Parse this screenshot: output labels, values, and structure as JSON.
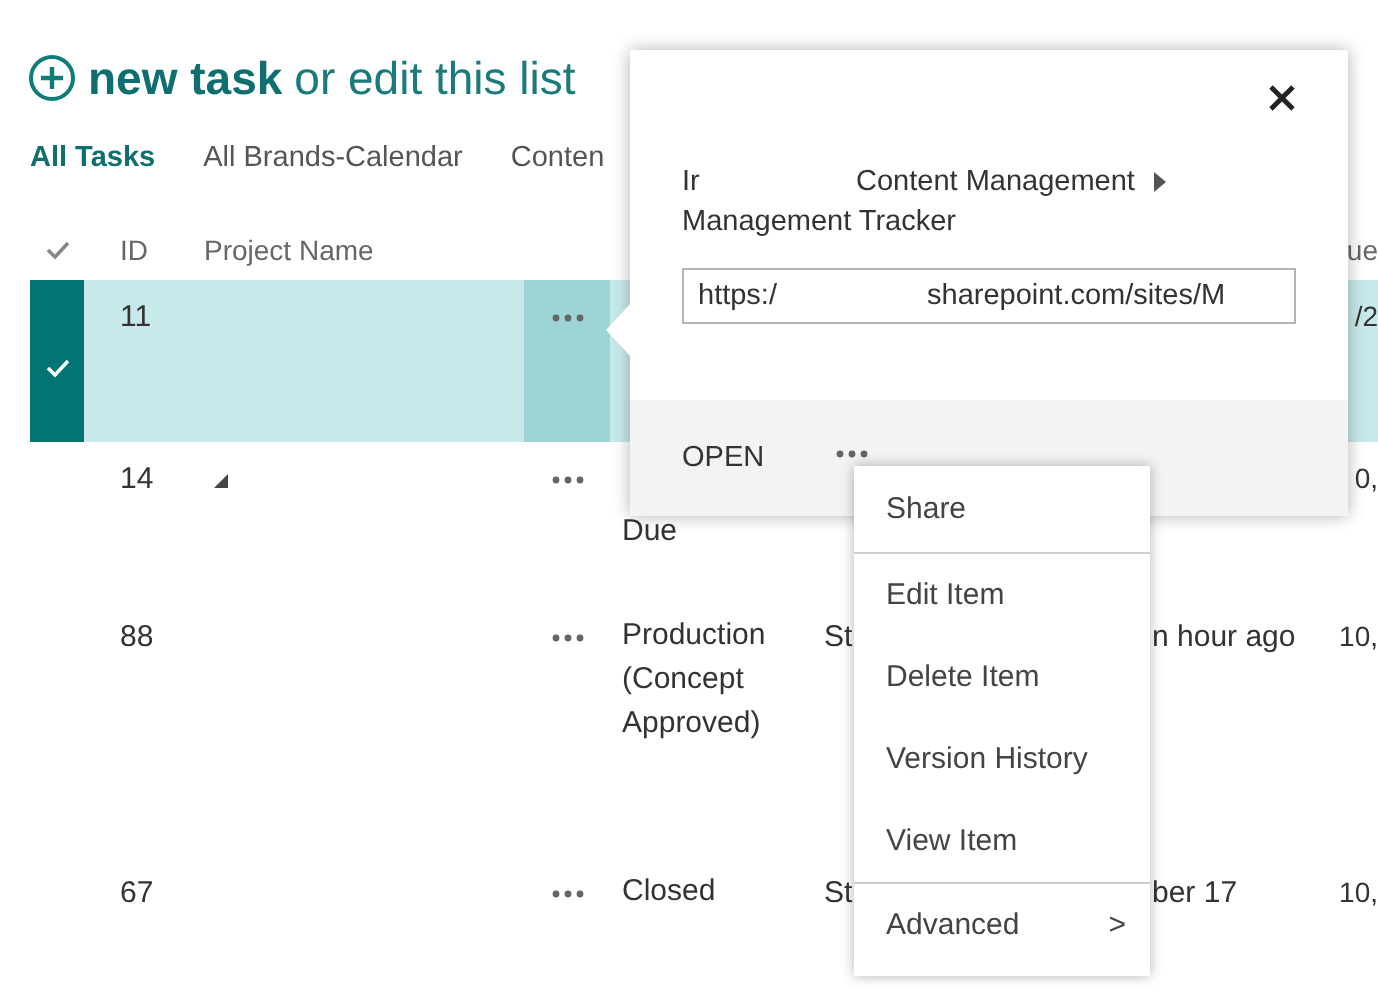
{
  "header": {
    "title_bold": "new task",
    "title_rest": "or edit this list"
  },
  "views": [
    {
      "label": "All Tasks",
      "selected": true
    },
    {
      "label": "All Brands-Calendar",
      "selected": false
    },
    {
      "label": "Conten",
      "selected": false
    }
  ],
  "table": {
    "columns": {
      "id": "ID",
      "project_name": "Project Name",
      "column_8": "ue"
    },
    "rows": [
      {
        "id": "11",
        "selected": true,
        "project_icon": false,
        "status": [],
        "status_first_line_covered": true,
        "due": "/2"
      },
      {
        "id": "14",
        "selected": false,
        "project_icon": true,
        "status": [
          "Due"
        ],
        "status_first_line_covered": true,
        "due": "0,"
      },
      {
        "id": "88",
        "selected": false,
        "project_icon": false,
        "status": [
          "Production",
          "(Concept",
          "Approved)"
        ],
        "status_first_line_covered": false,
        "column_6": "St",
        "modified": "n hour ago",
        "due": "10,"
      },
      {
        "id": "67",
        "selected": false,
        "project_icon": false,
        "status": [
          "Closed"
        ],
        "status_first_line_covered": false,
        "column_6": "St",
        "modified": "ber 17",
        "due": "10,"
      }
    ]
  },
  "callout": {
    "breadcrumb": [
      "Ir",
      "Content Management"
    ],
    "subtitle": "Management Tracker",
    "url": [
      "https:/",
      "sharepoint.com/sites/M"
    ],
    "open_label": "OPEN"
  },
  "menu": {
    "groups": [
      [
        {
          "label": "Share"
        }
      ],
      [
        {
          "label": "Edit Item"
        },
        {
          "label": "Delete Item"
        },
        {
          "label": "Version History"
        },
        {
          "label": "View Item"
        }
      ],
      [
        {
          "label": "Advanced",
          "arrow": ">"
        }
      ]
    ]
  }
}
